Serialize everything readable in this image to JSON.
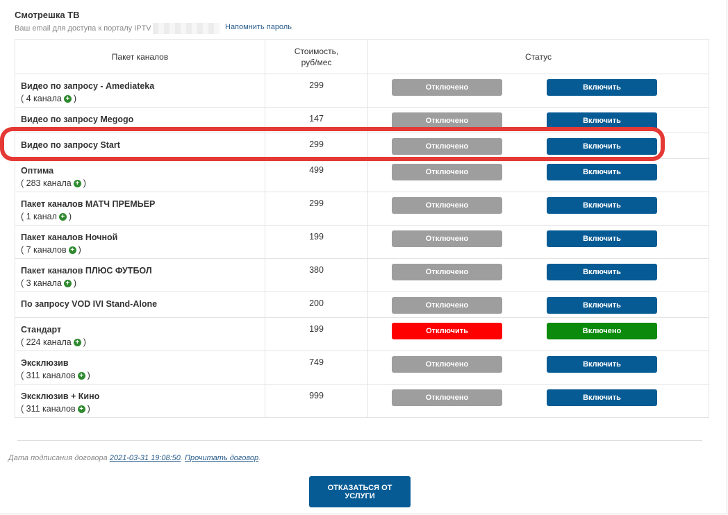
{
  "service": {
    "title": "Смотрешка ТВ",
    "email_label": "Ваш email для доступа к порталу IPTV",
    "remind_link": "Напомнить пароль"
  },
  "table": {
    "headers": [
      "Пакет каналов",
      "Стоимость, руб/мес",
      "Статус"
    ],
    "rows": [
      {
        "name": "Видео по запросу - Amediateka",
        "count": "( 4 канала",
        "count_end": ")",
        "price": "299",
        "btn1": "Отключено",
        "btn2": "Включить",
        "state": "off"
      },
      {
        "name": "Видео по запросу Megogo",
        "count": "",
        "count_end": "",
        "price": "147",
        "btn1": "Отключено",
        "btn2": "Включить",
        "state": "off"
      },
      {
        "name": "Видео по запросу Start",
        "count": "",
        "count_end": "",
        "price": "299",
        "btn1": "Отключено",
        "btn2": "Включить",
        "state": "off"
      },
      {
        "name": "Оптима",
        "count": "( 283 канала",
        "count_end": ")",
        "price": "499",
        "btn1": "Отключено",
        "btn2": "Включить",
        "state": "off"
      },
      {
        "name": "Пакет каналов МАТЧ ПРЕМЬЕР",
        "count": "( 1 канал",
        "count_end": ")",
        "price": "299",
        "btn1": "Отключено",
        "btn2": "Включить",
        "state": "off"
      },
      {
        "name": "Пакет каналов Ночной",
        "count": "( 7 каналов",
        "count_end": ")",
        "price": "199",
        "btn1": "Отключено",
        "btn2": "Включить",
        "state": "off"
      },
      {
        "name": "Пакет каналов ПЛЮС ФУТБОЛ",
        "count": "( 3 канала",
        "count_end": ")",
        "price": "380",
        "btn1": "Отключено",
        "btn2": "Включить",
        "state": "off"
      },
      {
        "name": "По запросу VOD IVI Stand-Alone",
        "count": "",
        "count_end": "",
        "price": "200",
        "btn1": "Отключено",
        "btn2": "Включить",
        "state": "off"
      },
      {
        "name": "Стандарт",
        "count": "( 224 канала",
        "count_end": ")",
        "price": "199",
        "btn1": "Отключить",
        "btn2": "Включено",
        "state": "on"
      },
      {
        "name": "Эксклюзив",
        "count": "( 311 каналов",
        "count_end": ")",
        "price": "749",
        "btn1": "Отключено",
        "btn2": "Включить",
        "state": "off"
      },
      {
        "name": "Эксклюзив + Кино",
        "count": "( 311 каналов",
        "count_end": ")",
        "price": "999",
        "btn1": "Отключено",
        "btn2": "Включить",
        "state": "off"
      }
    ]
  },
  "contract": {
    "label": "Дата подписания договора",
    "date": "2021-03-31 19:08:50",
    "sep": ".",
    "read_link": "Прочитать договор",
    "end": "."
  },
  "cancel_button": "ОТКАЗАТЬСЯ ОТ УСЛУГИ",
  "colors": {
    "primary": "#075b95",
    "disabled": "#9e9e9e",
    "danger": "#ff0000",
    "success": "#0b8a0b",
    "highlight": "#e53935"
  }
}
